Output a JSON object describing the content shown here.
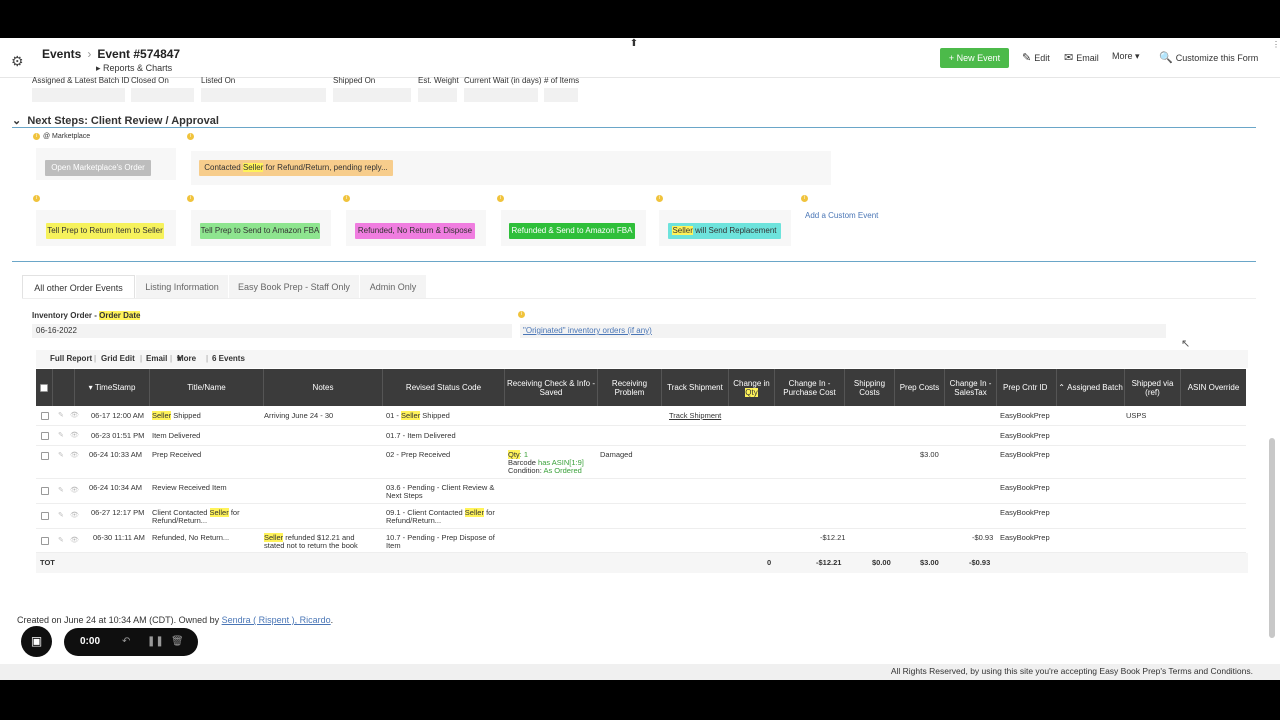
{
  "header": {
    "crumb_root": "Events",
    "crumb_event": "Event #574847",
    "sub_link": "Reports & Charts",
    "new_event": "+ New Event",
    "edit": "Edit",
    "email": "Email",
    "more": "More",
    "customize": "Customize this Form"
  },
  "fields": [
    "Assigned & Latest Batch ID",
    "Closed On",
    "Listed On",
    "Shipped On",
    "Est. Weight",
    "Current Wait (in days)",
    "# of Items"
  ],
  "next_steps": {
    "title": "Next Steps: Client Review / Approval",
    "marketplace_label": "@ Marketplace",
    "open_marketplace": "Open Marketplace's Order",
    "status_chip_pre": "Contacted ",
    "status_chip_hl": "Seller",
    "status_chip_post": " for Refund/Return, pending reply...",
    "actions": {
      "a1": "Tell Prep to Return Item to Seller",
      "a2": "Tell Prep to Send to Amazon FBA",
      "a3": "Refunded, No Return & Dispose",
      "a4": "Refunded & Send to Amazon FBA",
      "a5_hl": "Seller",
      "a5_rest": " will Send Replacement"
    },
    "add_custom": "Add a Custom Event"
  },
  "tabs": [
    "All other Order Events",
    "Listing Information",
    "Easy Book Prep - Staff Only",
    "Admin Only"
  ],
  "inventory": {
    "label_pre": "Inventory Order - ",
    "label_hl": "Order Date",
    "date": "06-16-2022",
    "originated": "\"Originated\" inventory orders (if any)"
  },
  "grid_toolbar": {
    "full_report": "Full Report",
    "grid_edit": "Grid Edit",
    "email": "Email",
    "more": "More",
    "events": "6 Events"
  },
  "columns": {
    "timestamp": "TimeStamp",
    "title": "Title/Name",
    "notes": "Notes",
    "revised": "Revised Status Code",
    "receiving_check": "Receiving Check & Info - Saved",
    "receiving_problem": "Receiving Problem",
    "track": "Track Shipment",
    "change_qty_pre": "Change in ",
    "change_qty_hl": "Qty",
    "change_cost": "Change In - Purchase Cost",
    "shipping": "Shipping Costs",
    "prep": "Prep Costs",
    "salestax": "Change In - SalesTax",
    "prep_cntr": "Prep Cntr ID",
    "assigned": "Assigned Batch",
    "shipped_via": "Shipped via (ref)",
    "asin": "ASIN Override"
  },
  "rows": {
    "r1": {
      "ts": "06-17 12:00 AM",
      "title_hl": "Seller",
      "title_rest": " Shipped",
      "notes": "Arriving June 24 - 30",
      "code_pre": "01  - ",
      "code_hl": "Seller",
      "code_post": " Shipped",
      "track": "Track Shipment",
      "prep_cntr": "EasyBookPrep",
      "shipped_via": "USPS"
    },
    "r2": {
      "ts": "06-23 01:51 PM",
      "title": "Item Delivered",
      "code": "01.7 - Item Delivered",
      "prep_cntr": "EasyBookPrep"
    },
    "r3": {
      "ts": "06-24 10:33 AM",
      "title": "Prep Received",
      "code": "02  - Prep Received",
      "qty_hl": "Qty",
      "qty_val": ": 1",
      "barcode_pre": "Barcode ",
      "barcode_green": "has ASIN[1:9]",
      "cond_pre": "Condition: ",
      "cond_green": "As Ordered",
      "problem": "Damaged",
      "prep_cost": "$3.00",
      "prep_cntr": "EasyBookPrep"
    },
    "r4": {
      "ts": "06-24 10:34 AM",
      "title": "Review Received Item",
      "code_l1": "03.6 - Pending - Client Review &",
      "code_l2": "Next Steps",
      "prep_cntr": "EasyBookPrep"
    },
    "r5": {
      "ts": "06-27 12:17 PM",
      "title_pre": "Client Contacted ",
      "title_hl": "Seller",
      "title_post": " for",
      "title_l2": "Refund/Return...",
      "code_pre": "09.1 - Client Contacted ",
      "code_hl": "Seller",
      "code_post": " for",
      "code_l2": "Refund/Return...",
      "prep_cntr": "EasyBookPrep"
    },
    "r6": {
      "ts": "06-30 11:11 AM",
      "title": "Refunded, No Return...",
      "notes_hl": "Seller",
      "notes_rest": " refunded $12.21 and",
      "notes_l2": "stated not to return the book",
      "code_l1": "10.7 - Pending - Prep Dispose of",
      "code_l2": "Item",
      "cost": "-$12.21",
      "salestax": "-$0.93",
      "prep_cntr": "EasyBookPrep"
    }
  },
  "totals": {
    "label": "TOT",
    "qty": "0",
    "cost": "-$12.21",
    "shipping": "$0.00",
    "prep": "$3.00",
    "salestax": "-$0.93"
  },
  "created": {
    "pre": "Created on June 24 at 10:34 AM (CDT). Owned by ",
    "owner": "Sendra ( Rispent ), Ricardo",
    "post": "."
  },
  "recorder": {
    "time": "0:00"
  },
  "footer": "All Rights Reserved, by using this site you're accepting Easy Book Prep's Terms and Conditions."
}
